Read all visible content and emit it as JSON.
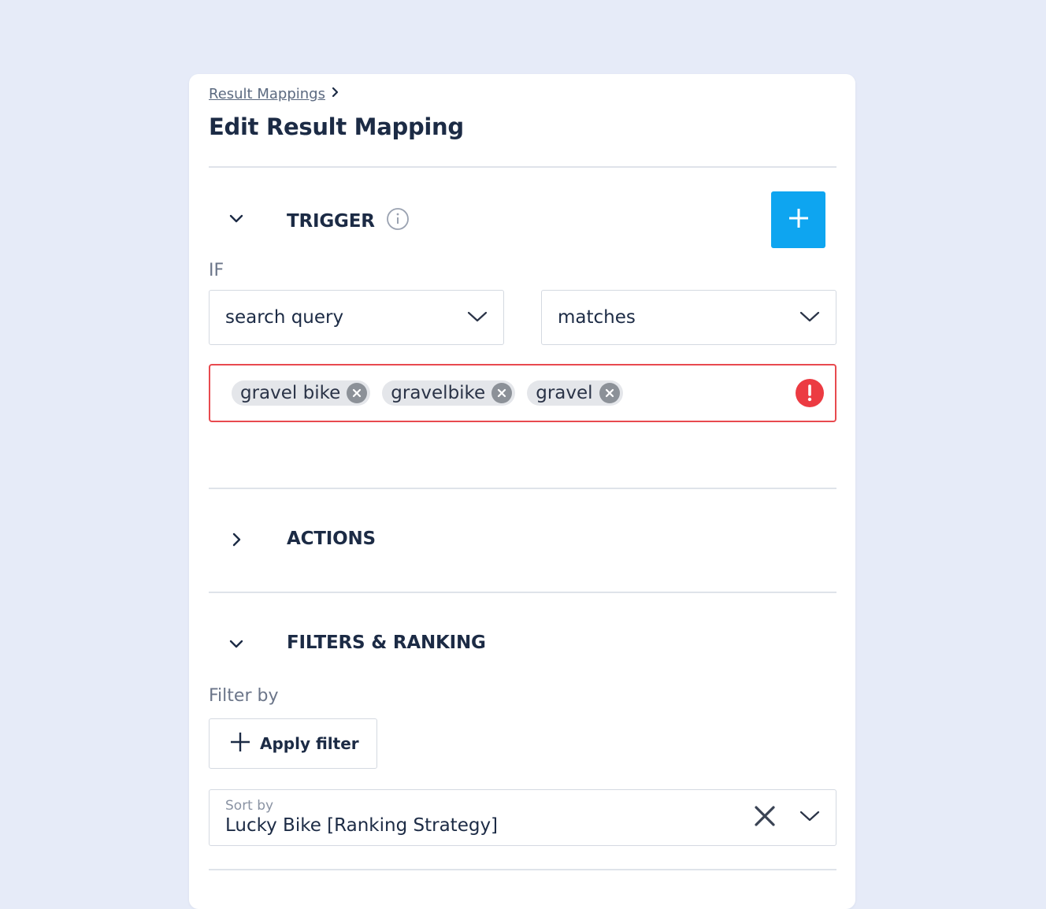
{
  "breadcrumb": {
    "parent": "Result Mappings"
  },
  "page": {
    "title": "Edit Result Mapping"
  },
  "trigger": {
    "title": "TRIGGER",
    "if_label": "IF",
    "field_select": "search query",
    "operator_select": "matches",
    "tags": [
      "gravel bike",
      "gravelbike",
      "gravel"
    ]
  },
  "actions": {
    "title": "ACTIONS"
  },
  "filters": {
    "title": "FILTERS & RANKING",
    "filter_by_label": "Filter by",
    "apply_filter_label": "Apply filter",
    "sort_label": "Sort by",
    "sort_value": "Lucky Bike [Ranking Strategy]"
  },
  "colors": {
    "background": "#e6ebf8",
    "accent": "#0ea5f0",
    "error": "#ec3b42",
    "text": "#1c2b45"
  }
}
